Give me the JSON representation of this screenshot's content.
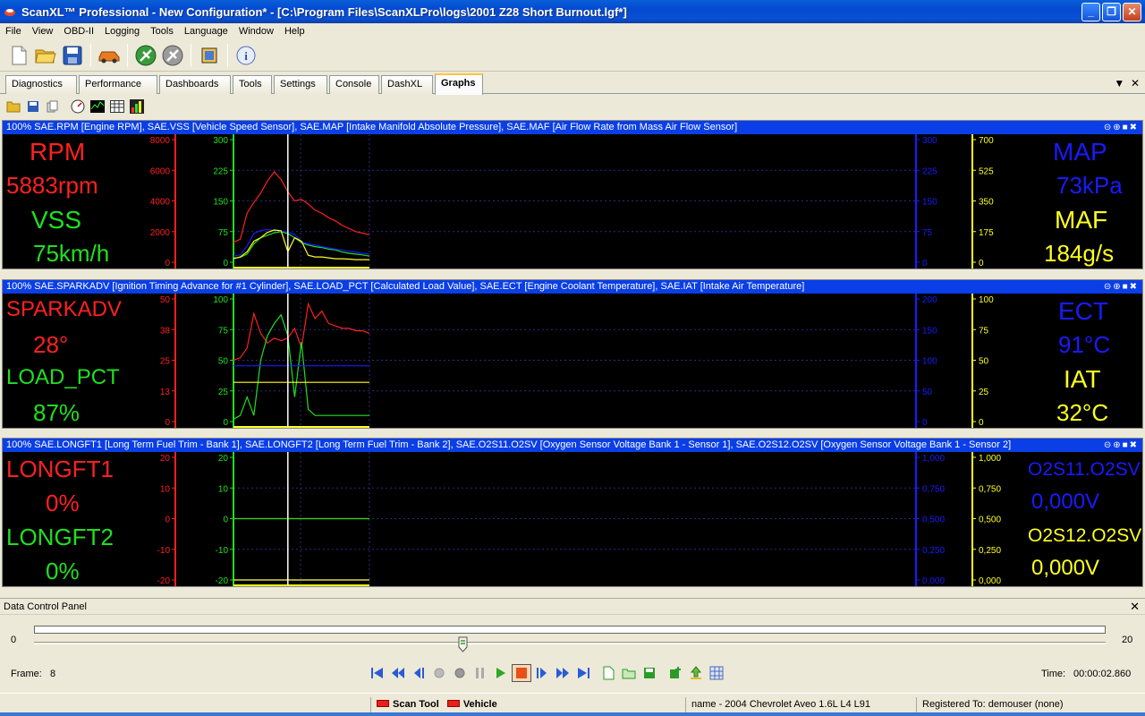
{
  "window": {
    "title": "ScanXL™ Professional - New Configuration* - [C:\\Program Files\\ScanXLPro\\logs\\2001 Z28 Short Burnout.lgf*]",
    "minimize": "_",
    "maximize": "❐",
    "close": "✕"
  },
  "menu": [
    "File",
    "View",
    "OBD-II",
    "Logging",
    "Tools",
    "Language",
    "Window",
    "Help"
  ],
  "tabs": [
    "Diagnostics",
    "Performance",
    "Dashboards",
    "Tools",
    "Settings",
    "Console",
    "DashXL",
    "Graphs"
  ],
  "active_tab": "Graphs",
  "panels": [
    {
      "header": "100% SAE.RPM [Engine RPM], SAE.VSS [Vehicle Speed Sensor], SAE.MAP [Intake Manifold Absolute Pressure], SAE.MAF [Air Flow Rate from Mass Air Flow Sensor]",
      "left": [
        {
          "name": "RPM",
          "value": "5883rpm",
          "color": "#ff2020"
        },
        {
          "name": "VSS",
          "value": "75km/h",
          "color": "#20e020"
        }
      ],
      "right": [
        {
          "name": "MAP",
          "value": "73kPa",
          "color": "#1a1aff"
        },
        {
          "name": "MAF",
          "value": "184g/s",
          "color": "#ffff20"
        }
      ],
      "axis_red": [
        "8000",
        "6000",
        "4000",
        "2000",
        "0"
      ],
      "axis_green": [
        "300",
        "225",
        "150",
        "75",
        "0"
      ],
      "axis_blue": [
        "300",
        "225",
        "150",
        "75",
        "0"
      ],
      "axis_yellow": [
        "700",
        "525",
        "350",
        "175",
        "0"
      ]
    },
    {
      "header": "100% SAE.SPARKADV [Ignition Timing Advance for #1 Cylinder], SAE.LOAD_PCT [Calculated Load Value], SAE.ECT [Engine Coolant Temperature], SAE.IAT [Intake Air Temperature]",
      "left": [
        {
          "name": "SPARKADV",
          "value": "28°",
          "color": "#ff2020"
        },
        {
          "name": "LOAD_PCT",
          "value": "87%",
          "color": "#20e020"
        }
      ],
      "right": [
        {
          "name": "ECT",
          "value": "91°C",
          "color": "#1a1aff"
        },
        {
          "name": "IAT",
          "value": "32°C",
          "color": "#ffff20"
        }
      ],
      "axis_red": [
        "50",
        "38",
        "25",
        "13",
        "0"
      ],
      "axis_green": [
        "100",
        "75",
        "50",
        "25",
        "0"
      ],
      "axis_blue": [
        "200",
        "150",
        "100",
        "50",
        "0"
      ],
      "axis_yellow": [
        "100",
        "75",
        "50",
        "25",
        "0"
      ]
    },
    {
      "header": "100% SAE.LONGFT1 [Long Term Fuel Trim - Bank 1], SAE.LONGFT2 [Long Term Fuel Trim - Bank 2], SAE.O2S11.O2SV [Oxygen Sensor Voltage Bank 1 - Sensor 1], SAE.O2S12.O2SV [Oxygen Sensor Voltage Bank 1 - Sensor 2]",
      "left": [
        {
          "name": "LONGFT1",
          "value": "0%",
          "color": "#ff2020"
        },
        {
          "name": "LONGFT2",
          "value": "0%",
          "color": "#20e020"
        }
      ],
      "right": [
        {
          "name": "O2S11.O2SV",
          "value": "0,000V",
          "color": "#1a1aff"
        },
        {
          "name": "O2S12.O2SV",
          "value": "0,000V",
          "color": "#ffff20"
        }
      ],
      "axis_red": [
        "20",
        "10",
        "0",
        "-10",
        "-20"
      ],
      "axis_green": [
        "20",
        "10",
        "0",
        "-10",
        "-20"
      ],
      "axis_blue": [
        "1,000",
        "0,750",
        "0,500",
        "0,250",
        "0,000"
      ],
      "axis_yellow": [
        "1,000",
        "0,750",
        "0,500",
        "0,250",
        "0,000"
      ]
    }
  ],
  "data_control": {
    "title": "Data Control Panel",
    "close": "✕",
    "slider_min": "0",
    "slider_max": "20",
    "slider_value": 8,
    "frame_label": "Frame:",
    "frame_value": "8",
    "time_label": "Time:",
    "time_value": "00:00:02.860"
  },
  "status": {
    "scan_tool": "Scan Tool",
    "vehicle": "Vehicle",
    "vehicle_name": "name - 2004 Chevrolet Aveo 1.6L L4 L91",
    "registered": "Registered To: demouser (none)"
  },
  "colors": {
    "red": "#ff2020",
    "green": "#20e020",
    "blue": "#1a1aff",
    "yellow": "#ffff20",
    "panel_header": "#0a3ee6"
  },
  "chart_data": [
    {
      "type": "line",
      "series": [
        {
          "name": "RPM",
          "x": [
            0,
            1,
            2,
            3,
            4,
            5,
            6,
            7,
            8,
            9,
            10,
            11,
            12,
            13,
            14,
            15,
            16,
            17,
            18,
            19,
            20
          ],
          "values": [
            1300,
            1500,
            3200,
            3900,
            4500,
            5300,
            5900,
            5400,
            4600,
            4000,
            4100,
            3800,
            3400,
            3200,
            2900,
            2700,
            2400,
            2200,
            2000,
            1900,
            1800
          ]
        },
        {
          "name": "VSS",
          "x": [
            0,
            1,
            2,
            3,
            4,
            5,
            6,
            7,
            8,
            9,
            10,
            11,
            12,
            13,
            14,
            15,
            16,
            17,
            18,
            19,
            20
          ],
          "values": [
            10,
            12,
            20,
            45,
            60,
            66,
            72,
            75,
            70,
            60,
            48,
            42,
            38,
            36,
            32,
            30,
            25,
            22,
            20,
            18,
            15
          ]
        },
        {
          "name": "MAP",
          "x": [
            0,
            1,
            2,
            3,
            4,
            5,
            6,
            7,
            8,
            9,
            10,
            11,
            12,
            13,
            14,
            15,
            16,
            17,
            18,
            19,
            20
          ],
          "values": [
            15,
            18,
            40,
            70,
            78,
            80,
            78,
            76,
            74,
            68,
            50,
            45,
            42,
            38,
            35,
            32,
            30,
            27,
            25,
            22,
            20
          ]
        },
        {
          "name": "MAF",
          "x": [
            0,
            1,
            2,
            3,
            4,
            5,
            6,
            7,
            8,
            9,
            10,
            11,
            12,
            13,
            14,
            15,
            16,
            17,
            18,
            19,
            20
          ],
          "values": [
            20,
            30,
            60,
            120,
            140,
            170,
            184,
            180,
            60,
            140,
            120,
            40,
            30,
            30,
            25,
            20,
            20,
            18,
            15,
            15,
            15
          ]
        }
      ],
      "ranges": {
        "RPM": [
          0,
          8000
        ],
        "VSS": [
          0,
          300
        ],
        "MAP": [
          0,
          300
        ],
        "MAF": [
          0,
          700
        ]
      }
    },
    {
      "type": "line",
      "series": [
        {
          "name": "SPARKADV",
          "x": [
            0,
            1,
            2,
            3,
            4,
            5,
            6,
            7,
            8,
            9,
            10,
            11,
            12,
            13,
            14,
            15,
            16,
            17,
            18,
            19,
            20
          ],
          "values": [
            25,
            26,
            30,
            44,
            36,
            32,
            34,
            33,
            34,
            38,
            30,
            48,
            42,
            45,
            40,
            39,
            38,
            38,
            37,
            37,
            36
          ]
        },
        {
          "name": "LOAD_PCT",
          "x": [
            0,
            1,
            2,
            3,
            4,
            5,
            6,
            7,
            8,
            9,
            10,
            11,
            12,
            13,
            14,
            15,
            16,
            17,
            18,
            19,
            20
          ],
          "values": [
            2,
            5,
            20,
            5,
            50,
            70,
            80,
            87,
            70,
            20,
            65,
            10,
            5,
            5,
            5,
            5,
            5,
            5,
            5,
            5,
            5
          ]
        },
        {
          "name": "ECT",
          "x": [
            0,
            1,
            2,
            3,
            4,
            5,
            6,
            7,
            8,
            9,
            10,
            11,
            12,
            13,
            14,
            15,
            16,
            17,
            18,
            19,
            20
          ],
          "values": [
            91,
            91,
            91,
            91,
            91,
            91,
            91,
            91,
            91,
            91,
            91,
            91,
            91,
            91,
            91,
            91,
            91,
            91,
            91,
            91,
            91
          ]
        },
        {
          "name": "IAT",
          "x": [
            0,
            1,
            2,
            3,
            4,
            5,
            6,
            7,
            8,
            9,
            10,
            11,
            12,
            13,
            14,
            15,
            16,
            17,
            18,
            19,
            20
          ],
          "values": [
            32,
            32,
            32,
            32,
            32,
            32,
            32,
            32,
            32,
            32,
            32,
            32,
            32,
            32,
            32,
            32,
            32,
            32,
            32,
            32,
            32
          ]
        }
      ],
      "ranges": {
        "SPARKADV": [
          0,
          50
        ],
        "LOAD_PCT": [
          0,
          100
        ],
        "ECT": [
          0,
          200
        ],
        "IAT": [
          0,
          100
        ]
      }
    },
    {
      "type": "line",
      "series": [
        {
          "name": "LONGFT1",
          "x": [
            0,
            20
          ],
          "values": [
            0,
            0
          ]
        },
        {
          "name": "LONGFT2",
          "x": [
            0,
            20
          ],
          "values": [
            0,
            0
          ]
        },
        {
          "name": "O2S11.O2SV",
          "x": [
            0,
            20
          ],
          "values": [
            0,
            0
          ]
        },
        {
          "name": "O2S12.O2SV",
          "x": [
            0,
            20
          ],
          "values": [
            0,
            0
          ]
        }
      ],
      "ranges": {
        "LONGFT1": [
          -20,
          20
        ],
        "LONGFT2": [
          -20,
          20
        ],
        "O2S11.O2SV": [
          0,
          1
        ],
        "O2S12.O2SV": [
          0,
          1
        ]
      }
    }
  ]
}
